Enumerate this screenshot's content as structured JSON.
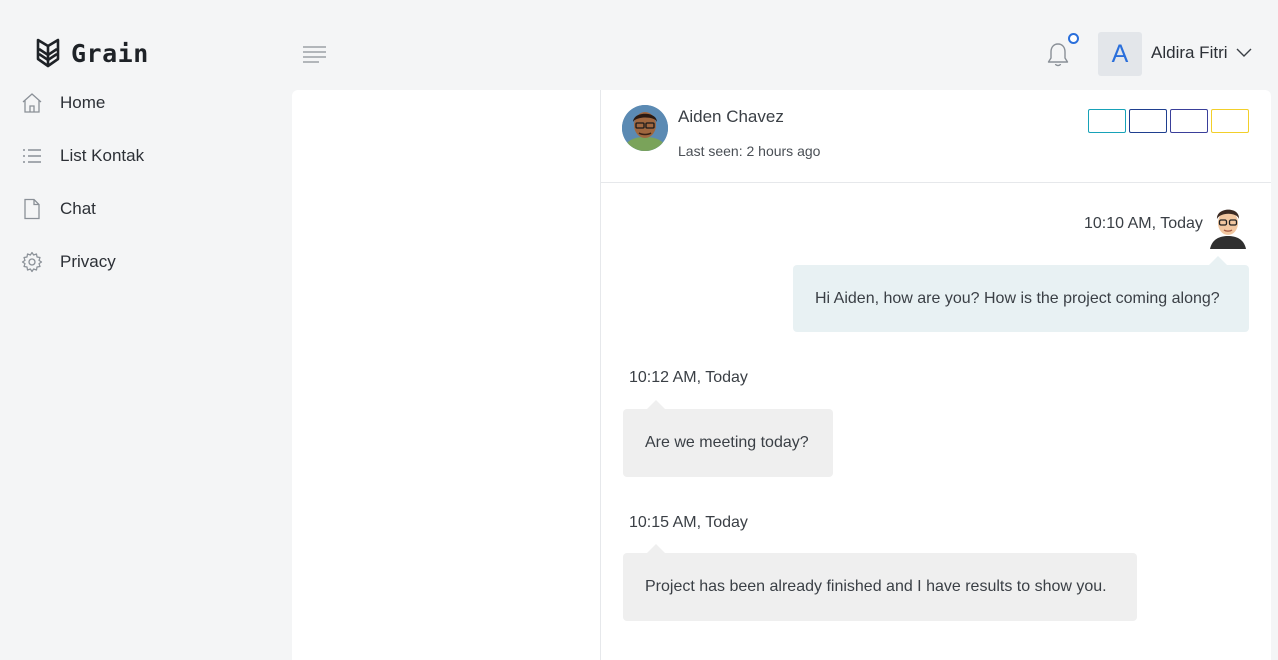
{
  "brand": {
    "name": "Grain",
    "logo_icon": "grain-logo-icon"
  },
  "sidebar": {
    "items": [
      {
        "label": "Home",
        "icon": "home-icon"
      },
      {
        "label": "List Kontak",
        "icon": "list-icon"
      },
      {
        "label": "Chat",
        "icon": "file-icon"
      },
      {
        "label": "Privacy",
        "icon": "gear-icon"
      }
    ]
  },
  "header": {
    "menu_icon": "hamburger-icon",
    "notification_icon": "bell-icon",
    "user": {
      "initial": "A",
      "name": "Aldira Fitri"
    }
  },
  "chat": {
    "contact": {
      "name": "Aiden Chavez",
      "last_seen": "Last seen: 2 hours ago"
    },
    "header_buttons": [
      {
        "color": "#17a2b8"
      },
      {
        "color": "#1f3f8f"
      },
      {
        "color": "#3a3f9a"
      },
      {
        "color": "#f2cf2a"
      }
    ],
    "messages": [
      {
        "from": "me",
        "time": "10:10 AM, Today",
        "text": "Hi Aiden, how are you? How is the project coming along?"
      },
      {
        "from": "them",
        "time": "10:12 AM, Today",
        "text": "Are we meeting today?"
      },
      {
        "from": "them",
        "time": "10:15 AM, Today",
        "text": "Project has been already finished and I have results to show you."
      }
    ]
  },
  "colors": {
    "accent": "#2a6fdb",
    "bubble_me": "#e8f1f3",
    "bubble_them": "#efefef"
  }
}
